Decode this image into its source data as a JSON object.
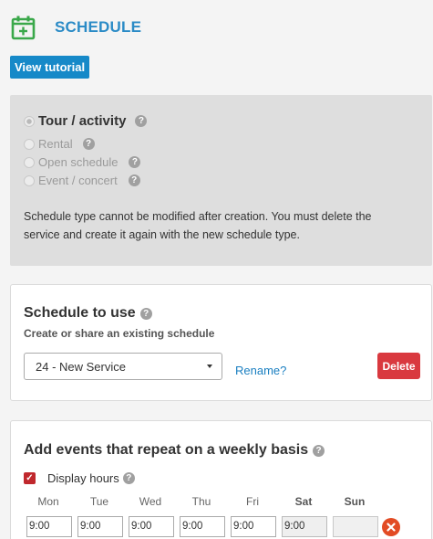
{
  "header": {
    "title": "SCHEDULE",
    "icon": "calendar-add-icon",
    "accent": "#2b8bc6",
    "icon_color": "#3aa84a"
  },
  "tutorial_button": "View tutorial",
  "schedule_type": {
    "options": [
      {
        "label": "Tour / activity",
        "selected": true
      },
      {
        "label": "Rental",
        "selected": false
      },
      {
        "label": "Open schedule",
        "selected": false
      },
      {
        "label": "Event / concert",
        "selected": false
      }
    ],
    "help_glyph": "?",
    "note": "Schedule type cannot be modified after creation. You must delete the service and create it again with the new schedule type."
  },
  "schedule_to_use": {
    "title": "Schedule to use",
    "subtitle": "Create or share an existing schedule",
    "selected": "24 - New Service",
    "rename_label": "Rename?",
    "delete_label": "Delete"
  },
  "weekly": {
    "title": "Add events that repeat on a weekly basis",
    "display_hours_label": "Display hours",
    "display_hours_checked": true,
    "days": [
      "Mon",
      "Tue",
      "Wed",
      "Thu",
      "Fri",
      "Sat",
      "Sun"
    ],
    "times": [
      "9:00",
      "9:00",
      "9:00",
      "9:00",
      "9:00",
      "9:00",
      ""
    ]
  },
  "colors": {
    "primary_button": "#1689c8",
    "delete_button": "#d9393f",
    "link": "#1a7fc1",
    "remove_icon": "#e24b24"
  }
}
